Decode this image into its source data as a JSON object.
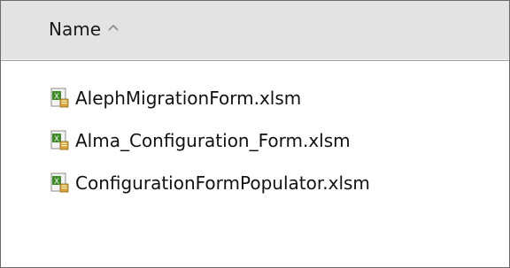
{
  "header": {
    "column_label": "Name",
    "sort_direction": "ascending"
  },
  "files": [
    {
      "name": "AlephMigrationForm.xlsm",
      "icon": "excel-macro-file-icon"
    },
    {
      "name": "Alma_Configuration_Form.xlsm",
      "icon": "excel-macro-file-icon"
    },
    {
      "name": "ConfigurationFormPopulator.xlsm",
      "icon": "excel-macro-file-icon"
    }
  ],
  "colors": {
    "header_bg": "#e3e3e3",
    "border": "#6a6a6a",
    "text": "#111111"
  }
}
